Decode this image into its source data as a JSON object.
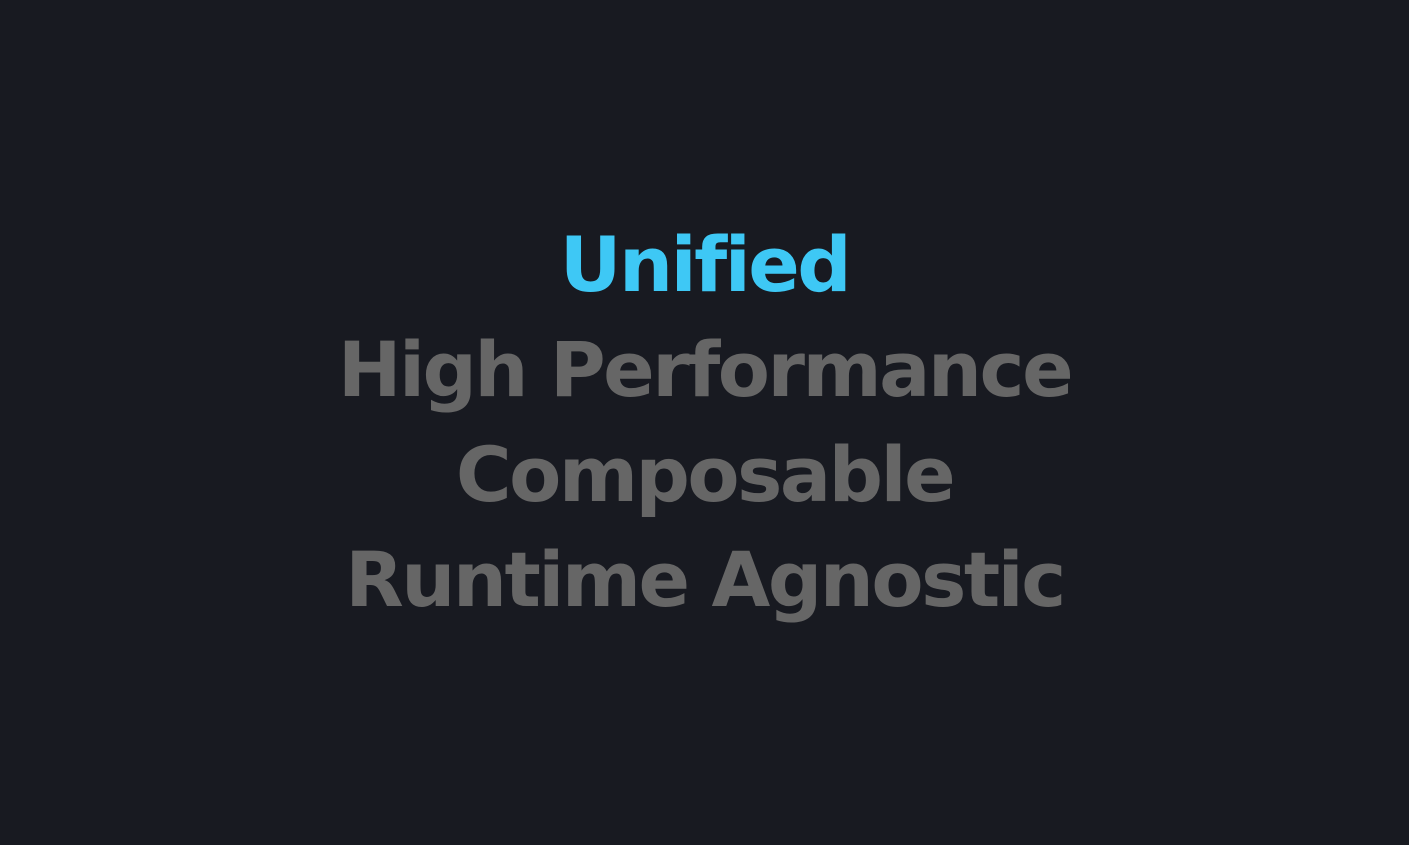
{
  "features": {
    "items": [
      {
        "label": "Unified",
        "active": true
      },
      {
        "label": "High Performance",
        "active": false
      },
      {
        "label": "Composable",
        "active": false
      },
      {
        "label": "Runtime Agnostic",
        "active": false
      }
    ]
  },
  "colors": {
    "background": "#181a21",
    "active_text": "#3ec8f5",
    "inactive_text": "#666666"
  }
}
